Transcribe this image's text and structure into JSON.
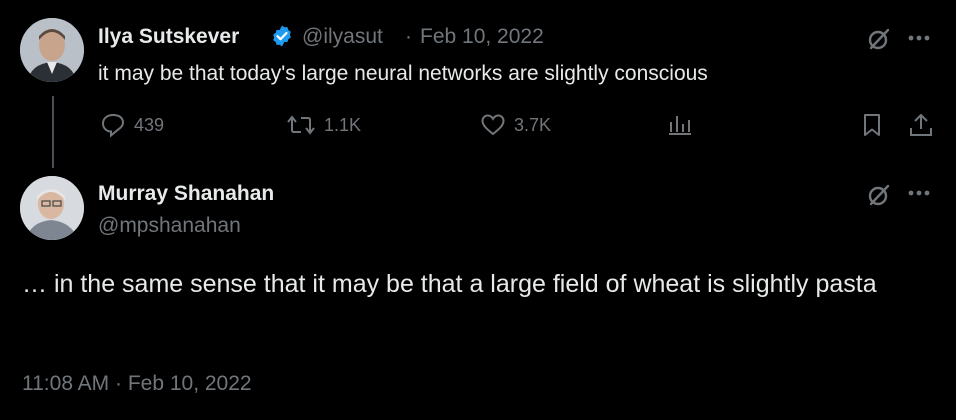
{
  "tweet": {
    "author_name": "Ilya Sutskever",
    "handle": "@ilyasut",
    "separator": "·",
    "date": "Feb 10, 2022",
    "text": "it may be that today's large neural networks are slightly conscious",
    "stats": {
      "replies": "439",
      "retweets": "1.1K",
      "likes": "3.7K"
    },
    "verified_color": "#1d9bf0"
  },
  "reply": {
    "author_name": "Murray Shanahan",
    "handle": "@mpshanahan",
    "text": "… in the same sense that it may be that a large field of wheat is slightly pasta",
    "timestamp": "11:08 AM · Feb 10, 2022"
  },
  "icons": {
    "grok": "grok-icon",
    "more": "more-icon",
    "reply": "reply-icon",
    "retweet": "retweet-icon",
    "like": "heart-icon",
    "views": "views-icon",
    "bookmark": "bookmark-icon",
    "share": "share-icon"
  },
  "colors": {
    "background": "#000000",
    "text": "#e7e9ea",
    "muted": "#71767b",
    "thread_line": "#4a4f55"
  }
}
